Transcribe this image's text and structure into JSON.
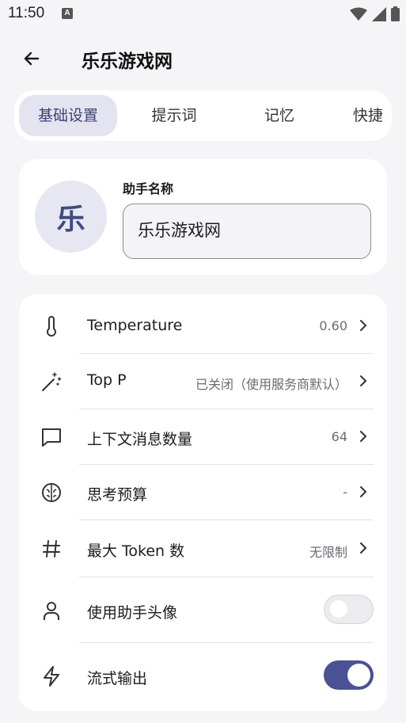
{
  "status_bar": {
    "time": "11:50",
    "notification_icon": "a-icon",
    "icons": [
      "wifi-icon",
      "signal-icon",
      "battery-icon"
    ]
  },
  "app_bar": {
    "back_icon": "arrow-back-icon",
    "title": "乐乐游戏网"
  },
  "tabs": [
    {
      "label": "基础设置",
      "active": true
    },
    {
      "label": "提示词",
      "active": false
    },
    {
      "label": "记忆",
      "active": false
    },
    {
      "label": "快捷",
      "active": false
    }
  ],
  "assistant": {
    "avatar_text": "乐",
    "name_label": "助手名称",
    "name_value": "乐乐游戏网"
  },
  "settings": {
    "temperature": {
      "icon": "thermometer-icon",
      "label": "Temperature",
      "value": "0.60"
    },
    "top_p": {
      "icon": "magic-wand-icon",
      "label": "Top P",
      "value": "已关闭（使用服务商默认）"
    },
    "context_count": {
      "icon": "message-icon",
      "label": "上下文消息数量",
      "value": "64"
    },
    "thinking_budget": {
      "icon": "brain-icon",
      "label": "思考预算",
      "value": "-"
    },
    "max_tokens": {
      "icon": "hash-icon",
      "label": "最大 Token 数",
      "value": "无限制"
    },
    "use_avatar": {
      "icon": "user-icon",
      "label": "使用助手头像",
      "enabled": false
    },
    "streaming": {
      "icon": "lightning-icon",
      "label": "流式输出",
      "enabled": true
    }
  },
  "colors": {
    "accent": "#4a5194",
    "tab_active_bg": "#e4e4f1",
    "avatar_bg": "#e6e7f2",
    "background": "#f5f5f7"
  }
}
